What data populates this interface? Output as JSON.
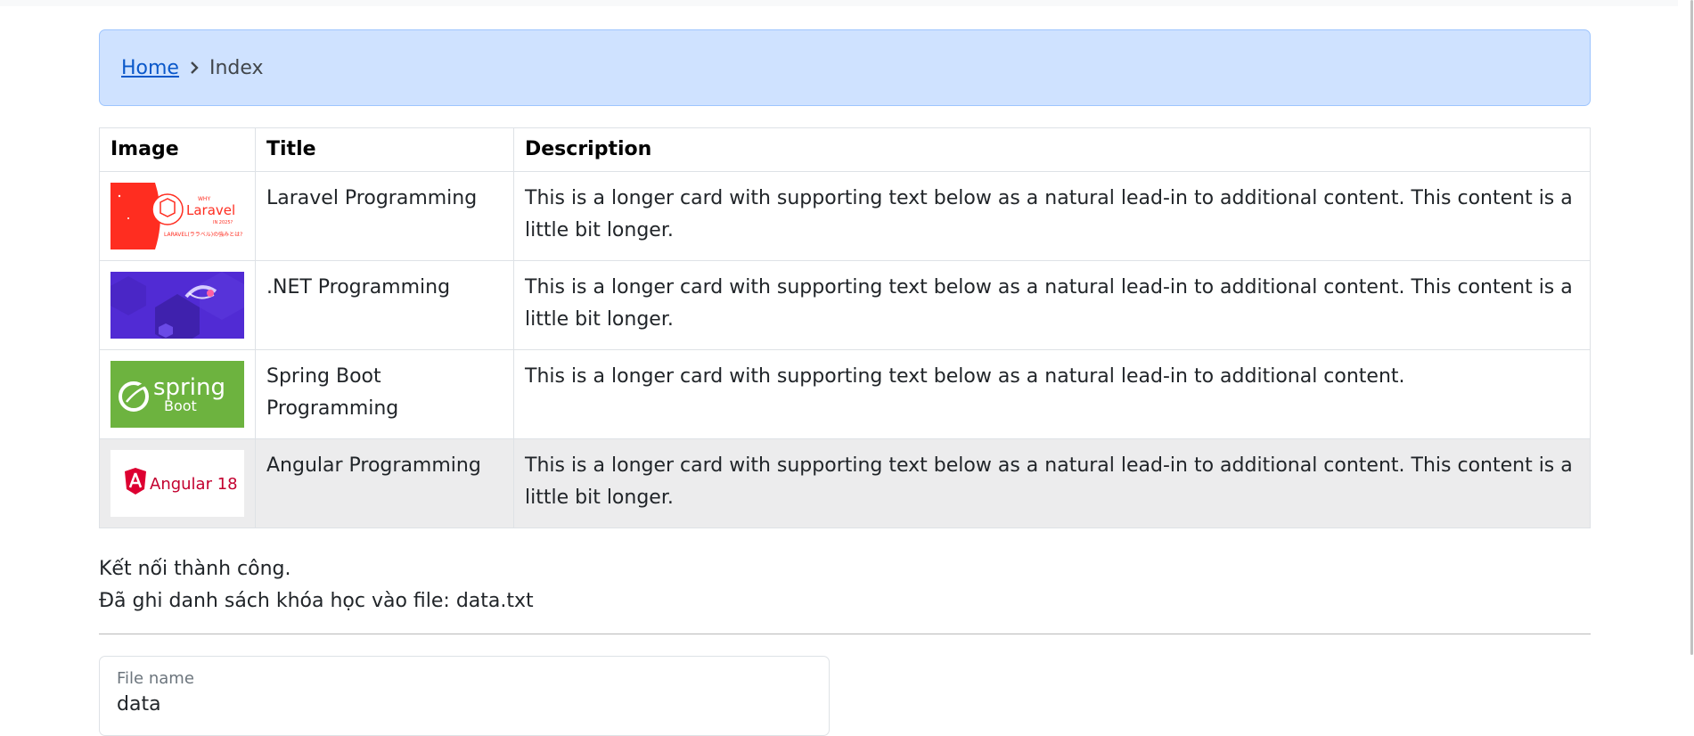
{
  "breadcrumb": {
    "home_label": "Home",
    "current_label": "Index"
  },
  "table": {
    "headers": {
      "image": "Image",
      "title": "Title",
      "description": "Description"
    },
    "rows": [
      {
        "title": "Laravel Programming",
        "description": "This is a longer card with supporting text below as a natural lead-in to additional content. This content is a little bit longer.",
        "image_text": "Laravel",
        "image_subtext": "WHY",
        "image_year": "IN 2025?",
        "image_caption": "LARAVEL(ララベル)の強みとは?"
      },
      {
        "title": ".NET Programming",
        "description": "This is a longer card with supporting text below as a natural lead-in to additional content. This content is a little bit longer."
      },
      {
        "title": "Spring Boot Programming",
        "description": "This is a longer card with supporting text below as a natural lead-in to additional content.",
        "image_text": "spring",
        "image_subtext": "Boot"
      },
      {
        "title": "Angular Programming",
        "description": "This is a longer card with supporting text below as a natural lead-in to additional content. This content is a little bit longer.",
        "image_text": "Angular 18"
      }
    ]
  },
  "status": {
    "line1": "Kết nối thành công.",
    "line2": "Đã ghi danh sách khóa học vào file: data.txt"
  },
  "file_field": {
    "label": "File name",
    "value": "data"
  },
  "colors": {
    "breadcrumb_bg": "#cfe2ff",
    "link": "#0a58ca",
    "laravel_red": "#ff2d20",
    "net_purple": "#512bd4",
    "spring_green": "#6db33f",
    "angular_magenta": "#dd0031"
  },
  "icons": {
    "breadcrumb_separator": "chevron-right-icon"
  }
}
